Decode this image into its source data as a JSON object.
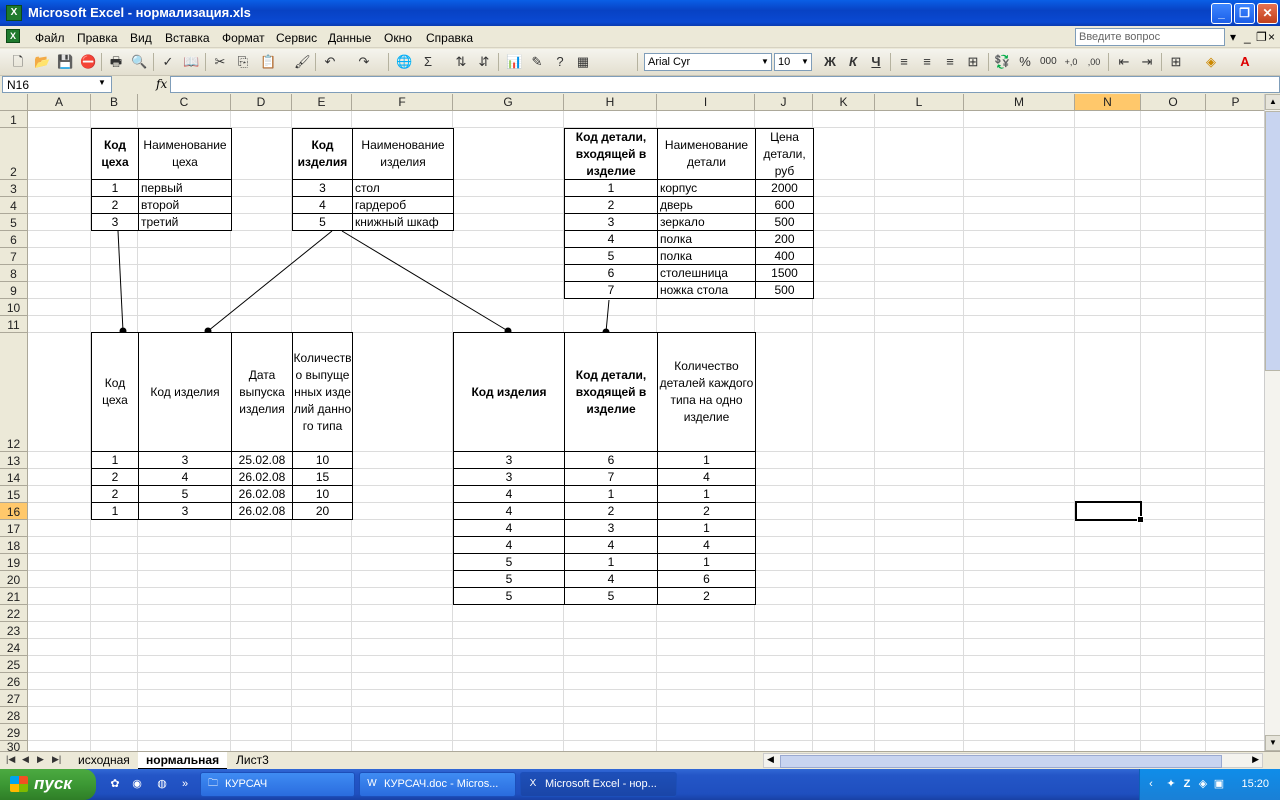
{
  "window": {
    "title": "Microsoft Excel - нормализация.xls"
  },
  "menu": {
    "items": [
      "Файл",
      "Правка",
      "Вид",
      "Вставка",
      "Формат",
      "Сервис",
      "Данные",
      "Окно",
      "Справка"
    ],
    "ask_placeholder": "Введите вопрос"
  },
  "toolbar": {
    "font": "Arial Cyr",
    "size": "10",
    "bold": "Ж",
    "italic": "К",
    "underline": "Ч"
  },
  "formula": {
    "namebox": "N16",
    "fx": "fx",
    "value": ""
  },
  "grid": {
    "columns": [
      "A",
      "B",
      "C",
      "D",
      "E",
      "F",
      "G",
      "H",
      "I",
      "J",
      "K",
      "L",
      "M",
      "N",
      "O",
      "P"
    ],
    "rows": [
      "1",
      "2",
      "3",
      "4",
      "5",
      "6",
      "7",
      "8",
      "9",
      "10",
      "11",
      "12",
      "13",
      "14",
      "15",
      "16",
      "17",
      "18",
      "19",
      "20",
      "21",
      "22",
      "23",
      "24",
      "25",
      "26",
      "27",
      "28",
      "29",
      "30"
    ],
    "selected_col": "N",
    "selected_row": "16"
  },
  "tables": {
    "workshops": {
      "headers": [
        "Код цеха",
        "Наименование цеха"
      ],
      "rows": [
        [
          "1",
          "первый"
        ],
        [
          "2",
          "второй"
        ],
        [
          "3",
          "третий"
        ]
      ]
    },
    "products": {
      "headers": [
        "Код изделия",
        "Наименование изделия"
      ],
      "rows": [
        [
          "3",
          "стол"
        ],
        [
          "4",
          "гардероб"
        ],
        [
          "5",
          "книжный шкаф"
        ]
      ]
    },
    "parts": {
      "headers": [
        "Код детали, входящей в изделие",
        "Наименование детали",
        "Цена детали, руб"
      ],
      "rows": [
        [
          "1",
          "корпус",
          "2000"
        ],
        [
          "2",
          "дверь",
          "600"
        ],
        [
          "3",
          "зеркало",
          "500"
        ],
        [
          "4",
          "полка",
          "200"
        ],
        [
          "5",
          "полка",
          "400"
        ],
        [
          "6",
          "столешница",
          "1500"
        ],
        [
          "7",
          "ножка стола",
          "500"
        ]
      ]
    },
    "production": {
      "headers": [
        "Код цеха",
        "Код изделия",
        "Дата выпуска изделия",
        "Количество выпущенных изделий данного типа"
      ],
      "rows": [
        [
          "1",
          "3",
          "25.02.08",
          "10"
        ],
        [
          "2",
          "4",
          "26.02.08",
          "15"
        ],
        [
          "2",
          "5",
          "26.02.08",
          "10"
        ],
        [
          "1",
          "3",
          "26.02.08",
          "20"
        ]
      ]
    },
    "composition": {
      "headers": [
        "Код изделия",
        "Код детали, входящей в изделие",
        "Количество деталей каждого типа на одно изделие"
      ],
      "rows": [
        [
          "3",
          "6",
          "1"
        ],
        [
          "3",
          "7",
          "4"
        ],
        [
          "4",
          "1",
          "1"
        ],
        [
          "4",
          "2",
          "2"
        ],
        [
          "4",
          "3",
          "1"
        ],
        [
          "4",
          "4",
          "4"
        ],
        [
          "5",
          "1",
          "1"
        ],
        [
          "5",
          "4",
          "6"
        ],
        [
          "5",
          "5",
          "2"
        ]
      ]
    }
  },
  "sheets": {
    "tabs": [
      "исходная",
      "нормальная",
      "Лист3"
    ],
    "active": "нормальная"
  },
  "taskbar": {
    "start": "пуск",
    "buttons": [
      "КУРСАЧ",
      "КУРСАЧ.doc - Micros...",
      "Microsoft Excel - нор..."
    ],
    "clock": "15:20"
  }
}
